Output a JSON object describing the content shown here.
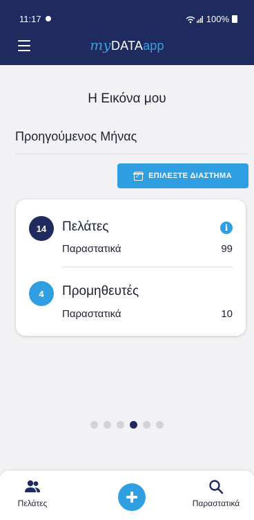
{
  "status_bar": {
    "time": "11:17",
    "battery": "100%"
  },
  "app_bar": {
    "logo_my": "my",
    "logo_data": "DATA",
    "logo_app": "app"
  },
  "page": {
    "title": "Η Εικόνα μου",
    "period_label": "Προηγούμενος Μήνας",
    "select_period_button": "ΕΠΙΛΕΞΤΕ ΔΙΑΣΤΗΜΑ"
  },
  "summary": {
    "clients": {
      "count": "14",
      "title": "Πελάτες",
      "docs_label": "Παραστατικά",
      "docs_value": "99"
    },
    "suppliers": {
      "count": "4",
      "title": "Προμηθευτές",
      "docs_label": "Παραστατικά",
      "docs_value": "10"
    }
  },
  "pager": {
    "total": 6,
    "active_index": 3
  },
  "bottom_nav": {
    "clients_label": "Πελάτες",
    "documents_label": "Παραστατικά"
  },
  "colors": {
    "primary_dark": "#1f2a5e",
    "accent_blue": "#2f9fe2",
    "background": "#f2f2f4"
  },
  "icons": {
    "menu": "hamburger-menu-icon",
    "calendar": "calendar-check-icon",
    "info": "info-icon",
    "clients": "people-icon",
    "add": "plus-icon",
    "search": "search-icon"
  }
}
